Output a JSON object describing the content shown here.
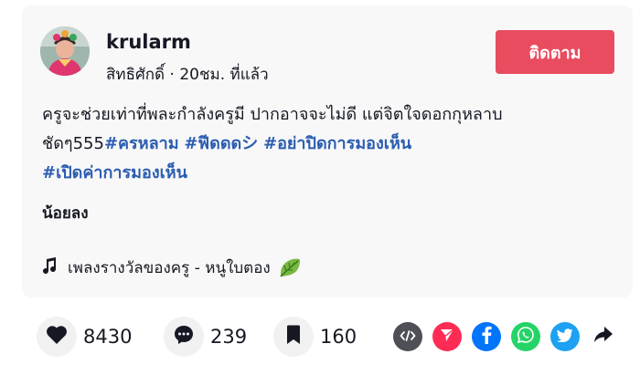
{
  "post": {
    "username": "krularm",
    "display_name": "สิทธิศักดิ์",
    "separator": " · ",
    "time_ago": "20ชม. ที่แล้ว",
    "follow_label": "ติดตาม",
    "caption_line1": "ครูจะช่วยเท่าที่พละกำลังครูมี ปากอาจจะไม่ดี แต่จิตใจดอกกุหลาบ",
    "caption_line2_prefix": "ชัดๆ555",
    "hashtags": [
      "#ครหลาม",
      "#ฟีดดดシ",
      "#อย่าปิดการมองเห็น",
      "#เปิดค่าการมองเห็น"
    ],
    "show_less_label": "น้อยลง",
    "music_title": "เพลงรางวัลของครู - หนูใบตอง"
  },
  "stats": {
    "likes": "8430",
    "comments": "239",
    "saves": "160"
  },
  "icons": {
    "like": "heart-icon",
    "comment": "comment-icon",
    "save": "bookmark-icon",
    "music": "music-note-icon",
    "embed": "embed-icon",
    "send": "send-icon",
    "facebook": "facebook-icon",
    "whatsapp": "whatsapp-icon",
    "twitter": "twitter-icon",
    "share": "share-arrow-icon"
  },
  "colors": {
    "follow_button": "#e84c5e",
    "hashtag": "#2b5db0",
    "embed": "#4f4f58",
    "send": "#fe2c55",
    "facebook": "#0075fa",
    "whatsapp": "#25d366",
    "twitter": "#1da1f2"
  }
}
